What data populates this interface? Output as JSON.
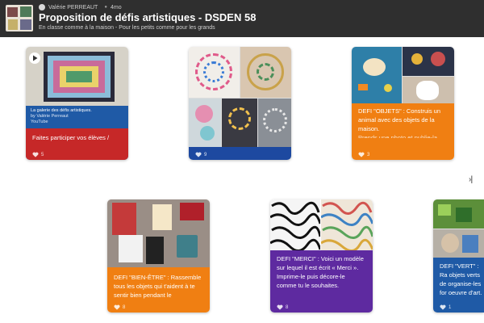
{
  "header": {
    "author": "Valérie PERREAUT",
    "time_ago": "4mo",
    "title": "Proposition de défis artistiques - DSDEN 58",
    "subtitle": "En classe comme à la maison - Pour les petits comme pour les grands"
  },
  "colors": {
    "header_bg": "#2f2f2f",
    "blue": "#1f5aa6",
    "red": "#c62828",
    "orange": "#f07f12",
    "purple": "#5e2aa0",
    "navy": "#1d49a0"
  },
  "cards": [
    {
      "media_caption_title": "La galerie des défis artistiques.",
      "media_caption_by": "by Valérie Perreaut",
      "media_caption_source": "YouTube",
      "text": "Faites participer vos élèves /",
      "likes": "5"
    },
    {
      "likes": "9"
    },
    {
      "text": "DEFI \"OBJETS\" : Construis un animal avec des objets de la maison.",
      "text_extra": "Prends une photo et publie-la",
      "likes": "3"
    },
    {
      "text": "DEFI \"BIEN-ÊTRE\" : Rassemble tous les objets qui t'aident à te sentir bien pendant le",
      "likes": "8"
    },
    {
      "text": "DEFI \"MERCI\" : Voici un modèle sur lequel il est écrit « Merci ». Imprime-le puis décore-le comme tu le souhaites.",
      "likes": "8"
    },
    {
      "text": "DEFI \"VERT\" : Ra objets verts de organise-les for oeuvre d'art.",
      "likes": "1"
    }
  ],
  "icons": {
    "play": "play-icon",
    "heart": "heart-icon",
    "next": "next-page-icon"
  },
  "next_label": "›|"
}
